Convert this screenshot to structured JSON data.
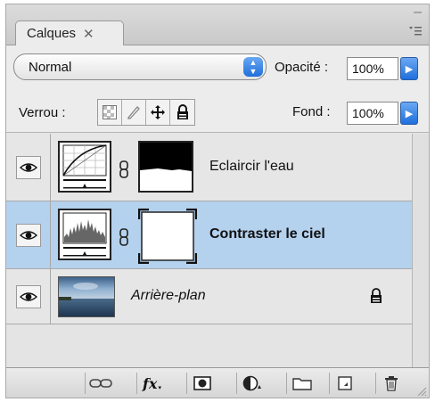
{
  "panel": {
    "tab_label": "Calques",
    "tab_close_glyph": "✕",
    "collapse_glyph": "–",
    "flyout_glyph": "▾≡"
  },
  "blend": {
    "mode": "Normal",
    "opacity_label": "Opacité :",
    "opacity_value": "100%"
  },
  "lock": {
    "label": "Verrou :",
    "buttons": [
      "lock-transparent-pixels-icon",
      "lock-image-pixels-icon",
      "lock-position-icon",
      "lock-all-icon"
    ],
    "fill_label": "Fond :",
    "fill_value": "100%"
  },
  "layers": [
    {
      "name": "Eclaircir l'eau",
      "type": "adjustment-curves",
      "visible": true,
      "selected": false
    },
    {
      "name": "Contraster le ciel",
      "type": "adjustment-levels",
      "visible": true,
      "selected": true
    },
    {
      "name": "Arrière-plan",
      "type": "image",
      "visible": true,
      "selected": false,
      "locked": true
    }
  ],
  "toolbar": {
    "buttons": [
      "link-layers-icon",
      "fx-icon",
      "add-mask-icon",
      "adjustment-layer-icon",
      "new-group-icon",
      "new-layer-icon",
      "trash-icon"
    ],
    "fx_label": "fx"
  },
  "colors": {
    "selection": "#b4d1ee",
    "accent": "#1f6fdc"
  }
}
